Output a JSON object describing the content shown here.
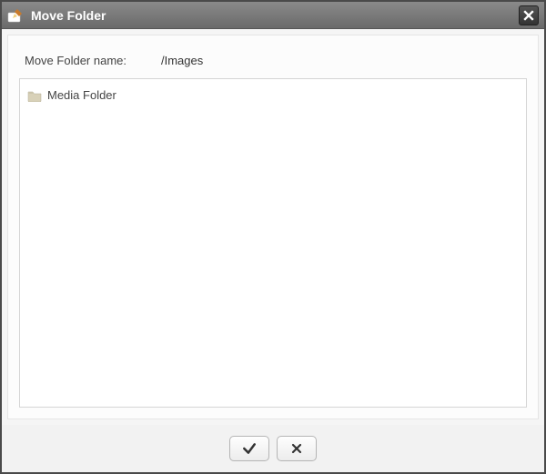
{
  "dialog": {
    "title": "Move Folder",
    "name_label": "Move Folder name:",
    "name_value": "/Images"
  },
  "tree": {
    "items": [
      {
        "label": "Media Folder"
      }
    ]
  }
}
